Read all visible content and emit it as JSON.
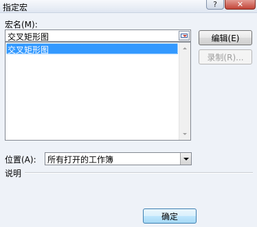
{
  "window": {
    "title": "指定宏",
    "help_symbol": "?",
    "close_symbol": "✕"
  },
  "macro_name": {
    "label": "宏名(M):",
    "value": "交叉矩形图",
    "list": [
      "交叉矩形图"
    ]
  },
  "buttons": {
    "edit": "编辑(E)",
    "record": "录制(R)...",
    "ok": "确定"
  },
  "location": {
    "label": "位置(A):",
    "value": "所有打开的工作簿"
  },
  "description": {
    "label": "说明"
  }
}
